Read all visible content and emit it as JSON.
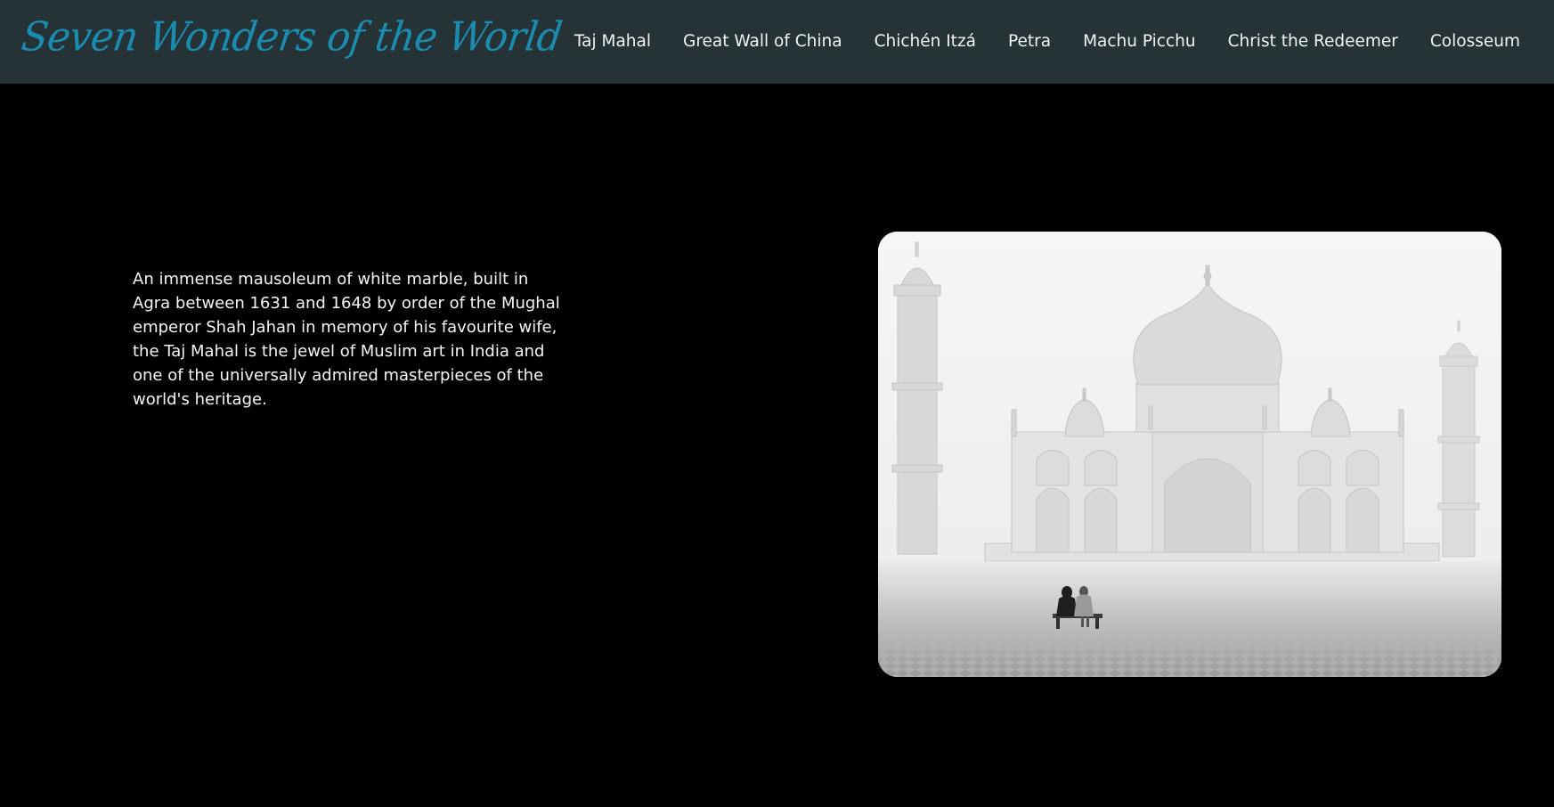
{
  "site": {
    "logo_text": "Seven Wonders of the World",
    "logo_color": "#1b8cb0",
    "header_bg": "#263336",
    "page_bg": "#000000"
  },
  "nav": {
    "items": [
      {
        "label": "Taj Mahal"
      },
      {
        "label": "Great Wall of China"
      },
      {
        "label": "Chichén Itzá"
      },
      {
        "label": "Petra"
      },
      {
        "label": "Machu Picchu"
      },
      {
        "label": "Christ the Redeemer"
      },
      {
        "label": "Colosseum"
      }
    ]
  },
  "main": {
    "description": "An immense mausoleum of white marble, built in Agra between 1631 and 1648 by order of the Mughal emperor Shah Jahan in memory of his favourite wife, the Taj Mahal is the jewel of Muslim art in India and one of the universally admired masterpieces of the world's heritage."
  }
}
